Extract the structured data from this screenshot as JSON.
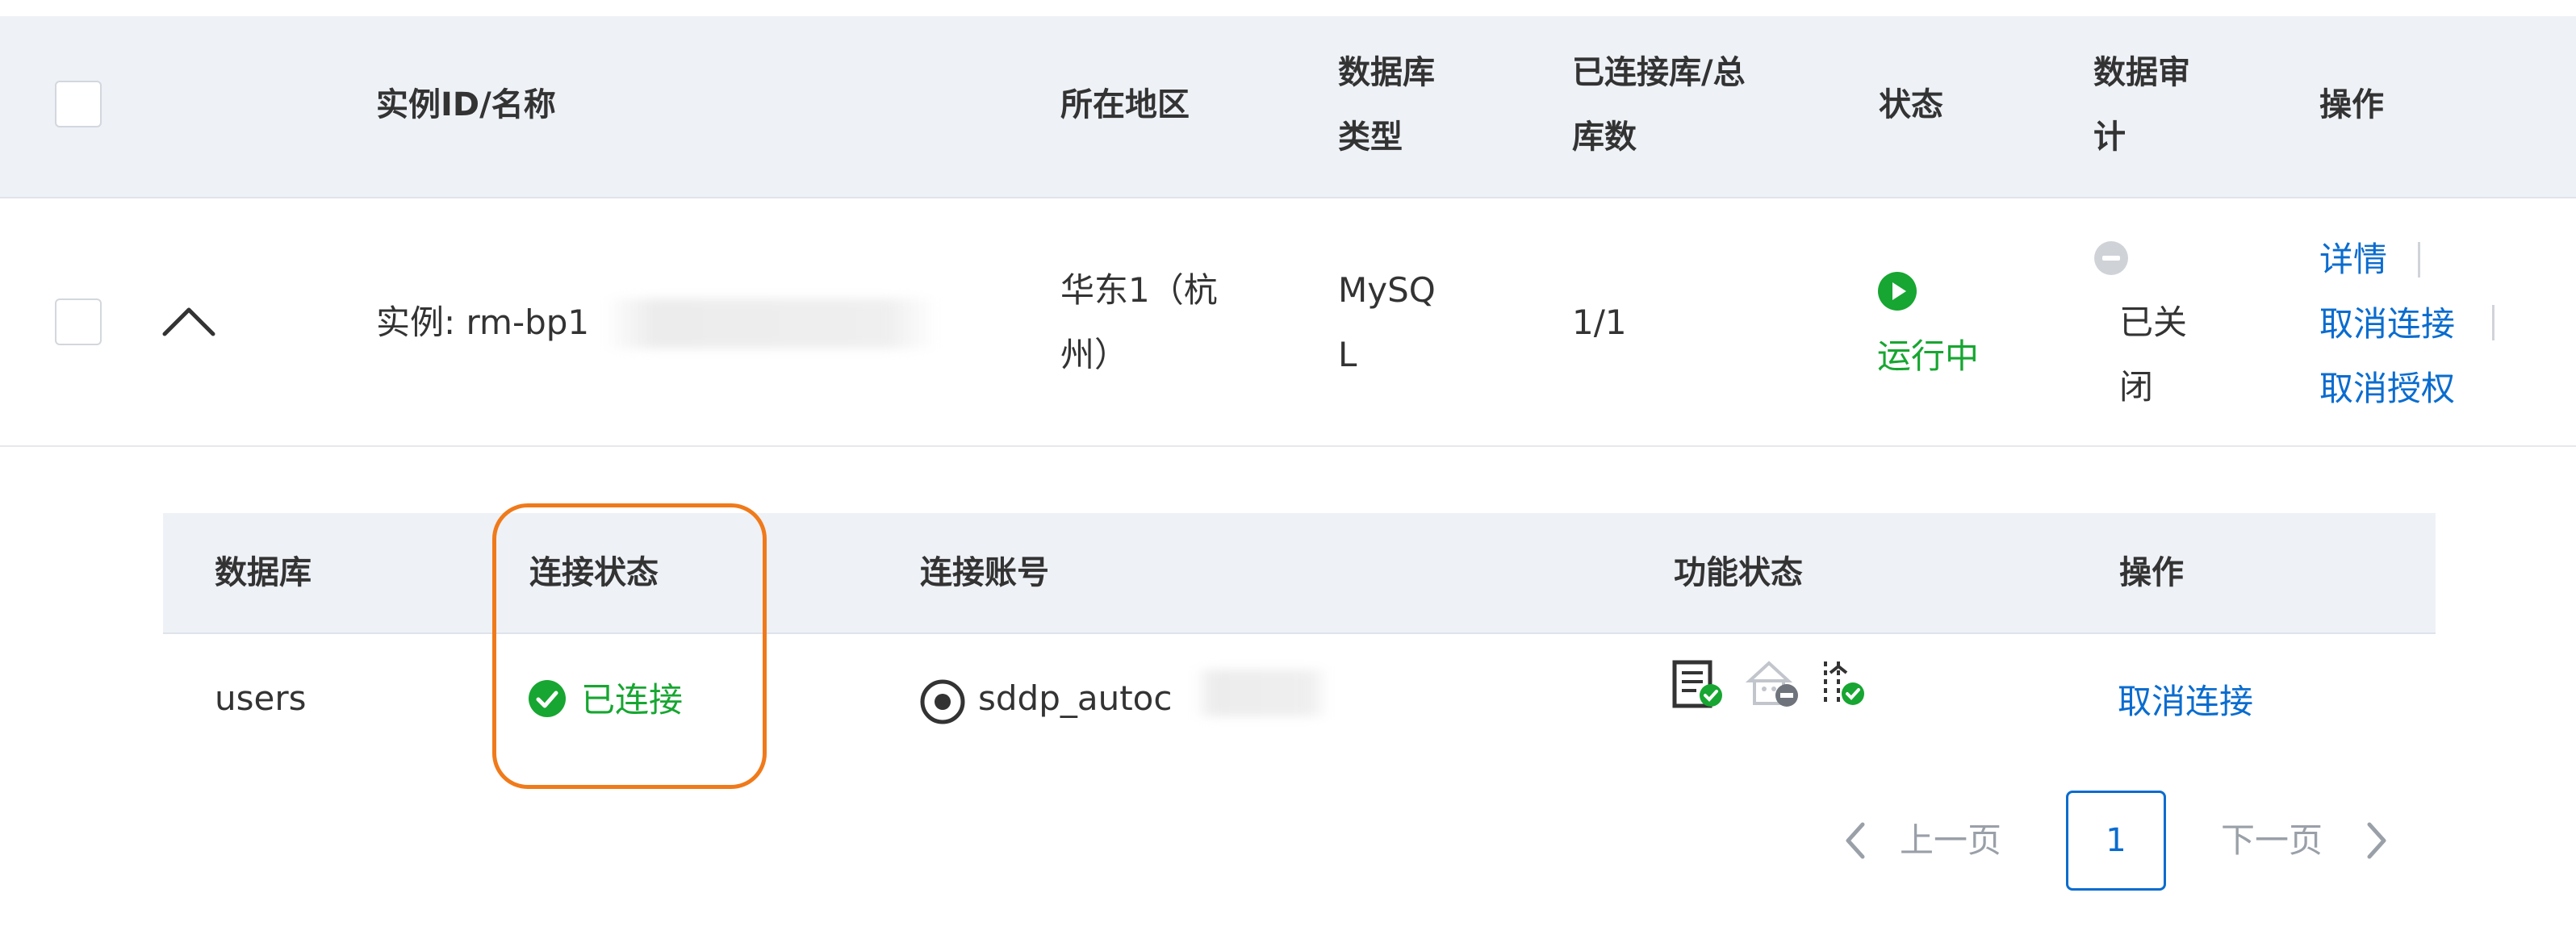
{
  "table": {
    "headers": {
      "instance": "实例ID/名称",
      "region": "所在地区",
      "db_type_line1": "数据库",
      "db_type_line2": "类型",
      "connected_line1": "已连接库/总",
      "connected_line2": "库数",
      "status": "状态",
      "audit_line1": "数据审",
      "audit_line2": "计",
      "actions": "操作"
    },
    "row": {
      "instance": "实例: rm-bp1",
      "region_line1": "华东1（杭",
      "region_line2": "州）",
      "db_type_line1": "MySQ",
      "db_type_line2": "L",
      "connected": "1/1",
      "status": "运行中",
      "audit_line1": "已关",
      "audit_line2": "闭",
      "actions": {
        "details": "详情",
        "cancel_connect": "取消连接",
        "revoke_auth": "取消授权"
      }
    }
  },
  "subtable": {
    "headers": {
      "database": "数据库",
      "connection_status": "连接状态",
      "account": "连接账号",
      "feature_status": "功能状态",
      "actions": "操作"
    },
    "row": {
      "database": "users",
      "connection_status": "已连接",
      "account": "sddp_autoc",
      "action": "取消连接"
    }
  },
  "pagination": {
    "prev": "上一页",
    "current": "1",
    "next": "下一页"
  },
  "colors": {
    "accent": "#0a6ccf",
    "success": "#17a631",
    "highlight": "#f07a1a",
    "header_bg": "#eef1f6"
  },
  "icons": [
    "chevron-up-icon",
    "play-circle-icon",
    "minus-circle-icon",
    "check-circle-icon",
    "eye-icon",
    "audit-log-icon",
    "disabled-home-icon",
    "data-flow-icon",
    "chevron-left-icon",
    "chevron-right-icon"
  ]
}
